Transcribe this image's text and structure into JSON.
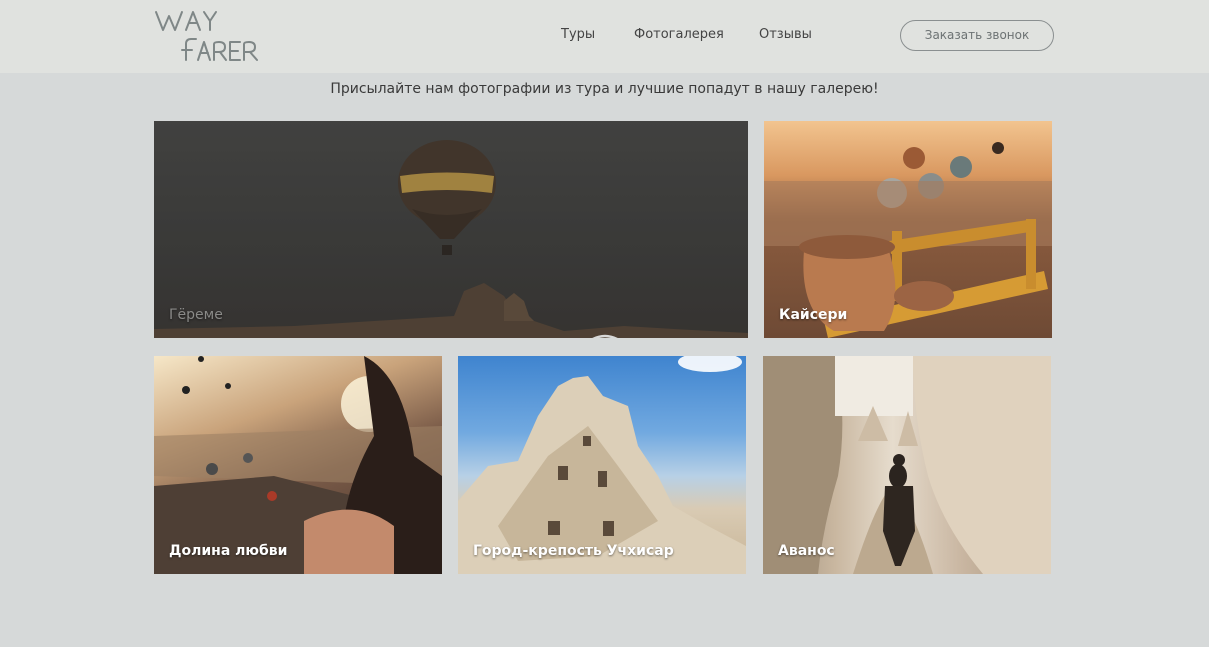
{
  "header": {
    "logo_text": "WAY FARER",
    "nav": [
      "Туры",
      "Фотогалерея",
      "Отзывы"
    ],
    "callback_button": "Заказать звонок"
  },
  "tagline": "Присылайте нам фотографии из тура и лучшие попадут в нашу галерею!",
  "gallery": [
    {
      "label": "Гёреме",
      "icon": "eye-icon"
    },
    {
      "label": "Кайсери"
    },
    {
      "label": "Долина любви"
    },
    {
      "label": "Город-крепость Учхисар"
    },
    {
      "label": "Аванос"
    }
  ]
}
